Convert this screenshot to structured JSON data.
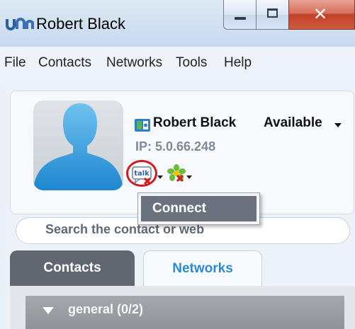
{
  "window": {
    "title": "Robert Black",
    "logo_text": "UN"
  },
  "menu": {
    "items": [
      "File",
      "Contacts",
      "Networks",
      "Tools",
      "Help"
    ]
  },
  "profile": {
    "name": "Robert Black",
    "availability": "Available",
    "ip": "IP: 5.0.66.248",
    "talk_icon_text": "talk"
  },
  "connect_menu": {
    "item": "Connect"
  },
  "search": {
    "placeholder": "Search the contact or web"
  },
  "tabs": {
    "contacts": "Contacts",
    "networks": "Networks"
  },
  "group": {
    "label": "general (0/2)"
  },
  "colors": {
    "title_bar": "#d3e1f1",
    "close_button": "#c2412a",
    "tab_active": "#5f6771",
    "tab_networks_text": "#2b8bd0",
    "highlight_circle": "#d11b1b"
  }
}
